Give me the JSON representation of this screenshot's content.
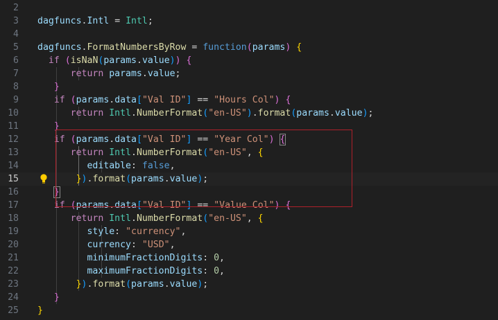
{
  "editor": {
    "language": "javascript",
    "active_line": "15",
    "annotation_color": "#b0202a",
    "lines": [
      {
        "num": "2",
        "tokens": [],
        "guides": []
      },
      {
        "num": "3",
        "tokens": [
          {
            "t": "dagfuncs",
            "c": "var"
          },
          {
            "t": ".",
            "c": "plain"
          },
          {
            "t": "Intl",
            "c": "var"
          },
          {
            "t": " = ",
            "c": "plain"
          },
          {
            "t": "Intl",
            "c": "type"
          },
          {
            "t": ";",
            "c": "plain"
          }
        ],
        "guides": []
      },
      {
        "num": "4",
        "tokens": [],
        "guides": []
      },
      {
        "num": "5",
        "tokens": [
          {
            "t": "dagfuncs",
            "c": "var"
          },
          {
            "t": ".",
            "c": "plain"
          },
          {
            "t": "FormatNumbersByRow",
            "c": "fn"
          },
          {
            "t": " = ",
            "c": "plain"
          },
          {
            "t": "function",
            "c": "bool"
          },
          {
            "t": "(",
            "c": "b2"
          },
          {
            "t": "params",
            "c": "var"
          },
          {
            "t": ") ",
            "c": "b2"
          },
          {
            "t": "{",
            "c": "b1"
          }
        ],
        "guides": []
      },
      {
        "num": "6",
        "tokens": [
          {
            "t": "  ",
            "c": "plain"
          },
          {
            "t": "if",
            "c": "kw"
          },
          {
            "t": " ",
            "c": "plain"
          },
          {
            "t": "(",
            "c": "b2"
          },
          {
            "t": "isNaN",
            "c": "fn"
          },
          {
            "t": "(",
            "c": "b3"
          },
          {
            "t": "params",
            "c": "var"
          },
          {
            "t": ".",
            "c": "plain"
          },
          {
            "t": "value",
            "c": "var"
          },
          {
            "t": ")",
            "c": "b3"
          },
          {
            "t": ")",
            "c": "b2"
          },
          {
            "t": " ",
            "c": "plain"
          },
          {
            "t": "{",
            "c": "b2"
          }
        ],
        "guides": []
      },
      {
        "num": "7",
        "tokens": [
          {
            "t": "      ",
            "c": "plain"
          },
          {
            "t": "return",
            "c": "kw"
          },
          {
            "t": " ",
            "c": "plain"
          },
          {
            "t": "params",
            "c": "var"
          },
          {
            "t": ".",
            "c": "plain"
          },
          {
            "t": "value",
            "c": "var"
          },
          {
            "t": ";",
            "c": "plain"
          }
        ],
        "guides": [
          0,
          1
        ]
      },
      {
        "num": "8",
        "tokens": [
          {
            "t": "   ",
            "c": "plain"
          },
          {
            "t": "}",
            "c": "b2"
          }
        ],
        "guides": [
          0
        ]
      },
      {
        "num": "9",
        "tokens": [
          {
            "t": "   ",
            "c": "plain"
          },
          {
            "t": "if",
            "c": "kw"
          },
          {
            "t": " ",
            "c": "plain"
          },
          {
            "t": "(",
            "c": "b2"
          },
          {
            "t": "params",
            "c": "var"
          },
          {
            "t": ".",
            "c": "plain"
          },
          {
            "t": "data",
            "c": "var"
          },
          {
            "t": "[",
            "c": "b3"
          },
          {
            "t": "\"Val ID\"",
            "c": "str"
          },
          {
            "t": "]",
            "c": "b3"
          },
          {
            "t": " == ",
            "c": "plain"
          },
          {
            "t": "\"Hours Col\"",
            "c": "str"
          },
          {
            "t": ")",
            "c": "b2"
          },
          {
            "t": " ",
            "c": "plain"
          },
          {
            "t": "{",
            "c": "b2"
          }
        ],
        "guides": [
          0
        ]
      },
      {
        "num": "10",
        "tokens": [
          {
            "t": "      ",
            "c": "plain"
          },
          {
            "t": "return",
            "c": "kw"
          },
          {
            "t": " ",
            "c": "plain"
          },
          {
            "t": "Intl",
            "c": "type"
          },
          {
            "t": ".",
            "c": "plain"
          },
          {
            "t": "NumberFormat",
            "c": "fn"
          },
          {
            "t": "(",
            "c": "b3"
          },
          {
            "t": "\"en-US\"",
            "c": "str"
          },
          {
            "t": ")",
            "c": "b3"
          },
          {
            "t": ".",
            "c": "plain"
          },
          {
            "t": "format",
            "c": "fn"
          },
          {
            "t": "(",
            "c": "b3"
          },
          {
            "t": "params",
            "c": "var"
          },
          {
            "t": ".",
            "c": "plain"
          },
          {
            "t": "value",
            "c": "var"
          },
          {
            "t": ")",
            "c": "b3"
          },
          {
            "t": ";",
            "c": "plain"
          }
        ],
        "guides": [
          0,
          1
        ]
      },
      {
        "num": "11",
        "tokens": [
          {
            "t": "   ",
            "c": "plain"
          },
          {
            "t": "}",
            "c": "b2"
          }
        ],
        "guides": [
          0
        ]
      },
      {
        "num": "12",
        "tokens": [
          {
            "t": "   ",
            "c": "plain"
          },
          {
            "t": "if",
            "c": "kw"
          },
          {
            "t": " ",
            "c": "plain"
          },
          {
            "t": "(",
            "c": "b2"
          },
          {
            "t": "params",
            "c": "var"
          },
          {
            "t": ".",
            "c": "plain"
          },
          {
            "t": "data",
            "c": "var"
          },
          {
            "t": "[",
            "c": "b3"
          },
          {
            "t": "\"Val ID\"",
            "c": "str"
          },
          {
            "t": "]",
            "c": "b3"
          },
          {
            "t": " == ",
            "c": "plain"
          },
          {
            "t": "\"Year Col\"",
            "c": "str"
          },
          {
            "t": ")",
            "c": "b2"
          },
          {
            "t": " ",
            "c": "plain"
          },
          {
            "t": "{",
            "c": "b2",
            "m": true
          }
        ],
        "guides": [
          0
        ]
      },
      {
        "num": "13",
        "tokens": [
          {
            "t": "      ",
            "c": "plain"
          },
          {
            "t": "return",
            "c": "kw"
          },
          {
            "t": " ",
            "c": "plain"
          },
          {
            "t": "Intl",
            "c": "type"
          },
          {
            "t": ".",
            "c": "plain"
          },
          {
            "t": "NumberFormat",
            "c": "fn"
          },
          {
            "t": "(",
            "c": "b3"
          },
          {
            "t": "\"en-US\"",
            "c": "str"
          },
          {
            "t": ", ",
            "c": "plain"
          },
          {
            "t": "{",
            "c": "b1"
          }
        ],
        "guides": [
          0,
          1
        ]
      },
      {
        "num": "14",
        "tokens": [
          {
            "t": "         ",
            "c": "plain"
          },
          {
            "t": "editable",
            "c": "var"
          },
          {
            "t": ": ",
            "c": "plain"
          },
          {
            "t": "false",
            "c": "bool"
          },
          {
            "t": ",",
            "c": "plain"
          }
        ],
        "guides": [
          0,
          1,
          2
        ]
      },
      {
        "num": "15",
        "tokens": [
          {
            "t": "      ",
            "c": "plain"
          },
          {
            "t": " ",
            "c": "plain"
          },
          {
            "t": "}",
            "c": "b1"
          },
          {
            "t": ")",
            "c": "b3"
          },
          {
            "t": ".",
            "c": "plain"
          },
          {
            "t": "format",
            "c": "fn"
          },
          {
            "t": "(",
            "c": "b3"
          },
          {
            "t": "params",
            "c": "var"
          },
          {
            "t": ".",
            "c": "plain"
          },
          {
            "t": "value",
            "c": "var"
          },
          {
            "t": ")",
            "c": "b3"
          },
          {
            "t": ";",
            "c": "plain"
          }
        ],
        "guides": [
          0,
          1
        ]
      },
      {
        "num": "16",
        "tokens": [
          {
            "t": "   ",
            "c": "plain"
          },
          {
            "t": "}",
            "c": "b2",
            "m": true
          }
        ],
        "guides": [
          0
        ]
      },
      {
        "num": "17",
        "tokens": [
          {
            "t": "   ",
            "c": "plain"
          },
          {
            "t": "if",
            "c": "kw"
          },
          {
            "t": " ",
            "c": "plain"
          },
          {
            "t": "(",
            "c": "b2"
          },
          {
            "t": "params",
            "c": "var"
          },
          {
            "t": ".",
            "c": "plain"
          },
          {
            "t": "data",
            "c": "var"
          },
          {
            "t": "[",
            "c": "b3"
          },
          {
            "t": "\"Val ID\"",
            "c": "str"
          },
          {
            "t": "]",
            "c": "b3"
          },
          {
            "t": " == ",
            "c": "plain"
          },
          {
            "t": "\"Value Col\"",
            "c": "str"
          },
          {
            "t": ")",
            "c": "b2"
          },
          {
            "t": " ",
            "c": "plain"
          },
          {
            "t": "{",
            "c": "b2"
          }
        ],
        "guides": [
          0
        ]
      },
      {
        "num": "18",
        "tokens": [
          {
            "t": "      ",
            "c": "plain"
          },
          {
            "t": "return",
            "c": "kw"
          },
          {
            "t": " ",
            "c": "plain"
          },
          {
            "t": "Intl",
            "c": "type"
          },
          {
            "t": ".",
            "c": "plain"
          },
          {
            "t": "NumberFormat",
            "c": "fn"
          },
          {
            "t": "(",
            "c": "b3"
          },
          {
            "t": "\"en-US\"",
            "c": "str"
          },
          {
            "t": ", ",
            "c": "plain"
          },
          {
            "t": "{",
            "c": "b1"
          }
        ],
        "guides": [
          0,
          1
        ]
      },
      {
        "num": "19",
        "tokens": [
          {
            "t": "         ",
            "c": "plain"
          },
          {
            "t": "style",
            "c": "var"
          },
          {
            "t": ": ",
            "c": "plain"
          },
          {
            "t": "\"currency\"",
            "c": "str"
          },
          {
            "t": ",",
            "c": "plain"
          }
        ],
        "guides": [
          0,
          1,
          2
        ]
      },
      {
        "num": "20",
        "tokens": [
          {
            "t": "         ",
            "c": "plain"
          },
          {
            "t": "currency",
            "c": "var"
          },
          {
            "t": ": ",
            "c": "plain"
          },
          {
            "t": "\"USD\"",
            "c": "str"
          },
          {
            "t": ",",
            "c": "plain"
          }
        ],
        "guides": [
          0,
          1,
          2
        ]
      },
      {
        "num": "21",
        "tokens": [
          {
            "t": "         ",
            "c": "plain"
          },
          {
            "t": "minimumFractionDigits",
            "c": "var"
          },
          {
            "t": ": ",
            "c": "plain"
          },
          {
            "t": "0",
            "c": "num"
          },
          {
            "t": ",",
            "c": "plain"
          }
        ],
        "guides": [
          0,
          1,
          2
        ]
      },
      {
        "num": "22",
        "tokens": [
          {
            "t": "         ",
            "c": "plain"
          },
          {
            "t": "maximumFractionDigits",
            "c": "var"
          },
          {
            "t": ": ",
            "c": "plain"
          },
          {
            "t": "0",
            "c": "num"
          },
          {
            "t": ",",
            "c": "plain"
          }
        ],
        "guides": [
          0,
          1,
          2
        ]
      },
      {
        "num": "23",
        "tokens": [
          {
            "t": "      ",
            "c": "plain"
          },
          {
            "t": " ",
            "c": "plain"
          },
          {
            "t": "}",
            "c": "b1"
          },
          {
            "t": ")",
            "c": "b3"
          },
          {
            "t": ".",
            "c": "plain"
          },
          {
            "t": "format",
            "c": "fn"
          },
          {
            "t": "(",
            "c": "b3"
          },
          {
            "t": "params",
            "c": "var"
          },
          {
            "t": ".",
            "c": "plain"
          },
          {
            "t": "value",
            "c": "var"
          },
          {
            "t": ")",
            "c": "b3"
          },
          {
            "t": ";",
            "c": "plain"
          }
        ],
        "guides": [
          0,
          1
        ]
      },
      {
        "num": "24",
        "tokens": [
          {
            "t": "   ",
            "c": "plain"
          },
          {
            "t": "}",
            "c": "b2"
          }
        ],
        "guides": [
          0
        ]
      },
      {
        "num": "25",
        "tokens": [
          {
            "t": "}",
            "c": "b1"
          }
        ],
        "guides": []
      }
    ]
  }
}
